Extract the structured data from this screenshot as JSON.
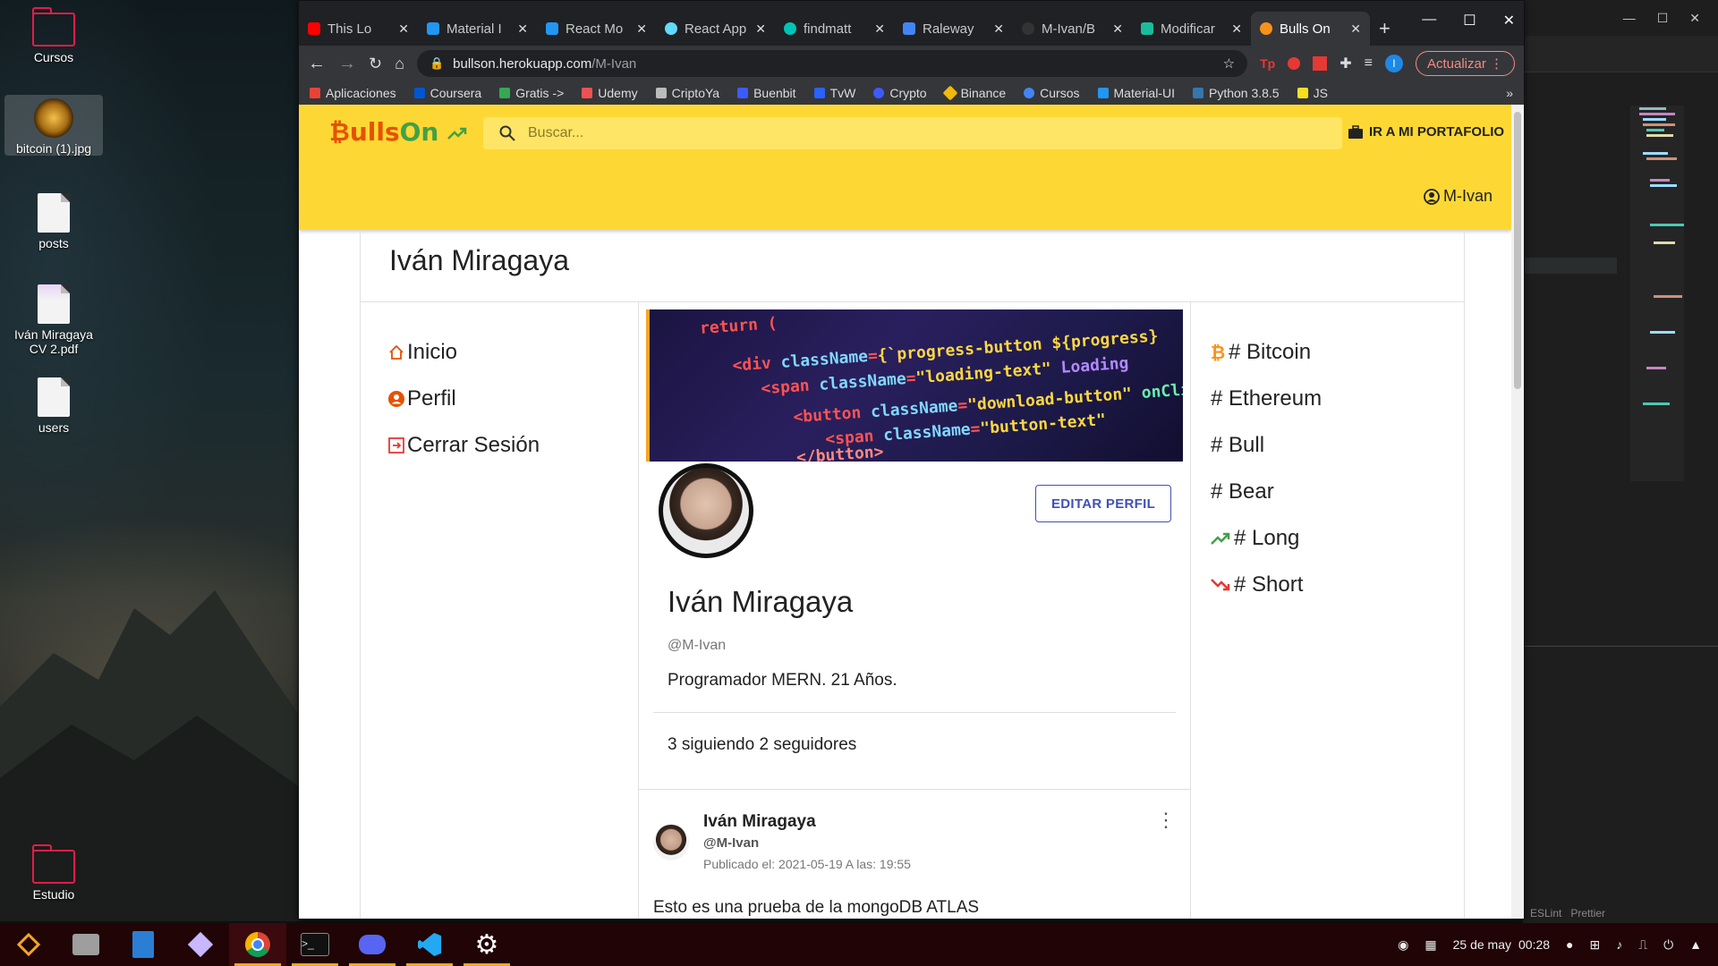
{
  "desktop": {
    "icons": [
      {
        "label": "Cursos"
      },
      {
        "label": "bitcoin (1).jpg"
      },
      {
        "label": "posts"
      },
      {
        "label": "Iván Miragaya CV 2.pdf"
      },
      {
        "label": "users"
      },
      {
        "label": "Estudio"
      }
    ]
  },
  "taskbar": {
    "clock_date": "25 de may",
    "clock_time": "00:28",
    "accent": "#f5a623"
  },
  "editor": {
    "status_items": [
      "ESLint",
      "Prettier"
    ]
  },
  "browser": {
    "tabs": [
      {
        "title": "This Lo",
        "icon": "youtube-icon",
        "color": "#ff0000"
      },
      {
        "title": "Material I",
        "icon": "material-ui-icon",
        "color": "#2196f3"
      },
      {
        "title": "React Mo",
        "icon": "material-ui-icon",
        "color": "#2196f3"
      },
      {
        "title": "React App",
        "icon": "react-icon",
        "color": "#61dafb"
      },
      {
        "title": "findmatt",
        "icon": "site-icon",
        "color": "#00c4b4"
      },
      {
        "title": "Raleway",
        "icon": "google-fonts-icon",
        "color": "#4285f4"
      },
      {
        "title": "M-Ivan/B",
        "icon": "github-icon",
        "color": "#333333"
      },
      {
        "title": "Modificar",
        "icon": "realpython-icon",
        "color": "#1abc9c"
      },
      {
        "title": "Bulls On",
        "icon": "bitcoin-icon",
        "color": "#f7931a"
      }
    ],
    "url_host": "bullson.herokuapp.com",
    "url_path": "/M-Ivan",
    "update_label": "Actualizar",
    "profile_initial": "I",
    "bookmarks": [
      {
        "label": "Aplicaciones",
        "color": "#ea4335"
      },
      {
        "label": "Coursera",
        "color": "#0056d2"
      },
      {
        "label": "Gratis ->",
        "color": "#34a853"
      },
      {
        "label": "Udemy",
        "color": "#ec5252"
      },
      {
        "label": "CriptoYa",
        "color": "#bbbbbb"
      },
      {
        "label": "Buenbit",
        "color": "#3d5afe"
      },
      {
        "label": "TvW",
        "color": "#2962ff"
      },
      {
        "label": "Crypto",
        "color": "#3d5afe"
      },
      {
        "label": "Binance",
        "color": "#f0b90b"
      },
      {
        "label": "Cursos",
        "color": "#4285f4"
      },
      {
        "label": "Material-UI",
        "color": "#2196f3"
      },
      {
        "label": "Python 3.8.5",
        "color": "#3776ab"
      },
      {
        "label": "JS",
        "color": "#f7df1e"
      }
    ]
  },
  "app": {
    "logo_bulls": "₿ulls",
    "logo_on": "On",
    "search_placeholder": "Buscar...",
    "portfolio_label": "IR A MI PORTAFOLIO",
    "user_label": "M-Ivan",
    "page_title": "Iván Miragaya",
    "left_nav": [
      {
        "label": "Inicio",
        "icon": "home-icon"
      },
      {
        "label": "Perfil",
        "icon": "account-circle-icon"
      },
      {
        "label": "Cerrar Sesión",
        "icon": "logout-icon"
      }
    ],
    "profile": {
      "edit_label": "EDITAR PERFIL",
      "name": "Iván Miragaya",
      "handle": "@M-Ivan",
      "bio": "Programador MERN. 21 Años.",
      "follow_stats": "3 siguiendo 2 seguidores"
    },
    "post": {
      "author": "Iván Miragaya",
      "handle": "@M-Ivan",
      "date": "Publicado el: 2021-05-19 A las: 19:55",
      "text": "Esto es una prueba de la mongoDB ATLAS"
    },
    "tags": [
      {
        "label": "# Bitcoin",
        "icon": "bitcoin-icon"
      },
      {
        "label": "# Ethereum",
        "icon": ""
      },
      {
        "label": "# Bull",
        "icon": ""
      },
      {
        "label": "# Bear",
        "icon": ""
      },
      {
        "label": "# Long",
        "icon": "trending-up-icon"
      },
      {
        "label": "# Short",
        "icon": "trending-down-icon"
      }
    ],
    "colors": {
      "appbar": "#fdd835",
      "logo_bulls": "#e65100",
      "logo_on": "#43a047",
      "button_primary": "#3f51b5"
    }
  }
}
